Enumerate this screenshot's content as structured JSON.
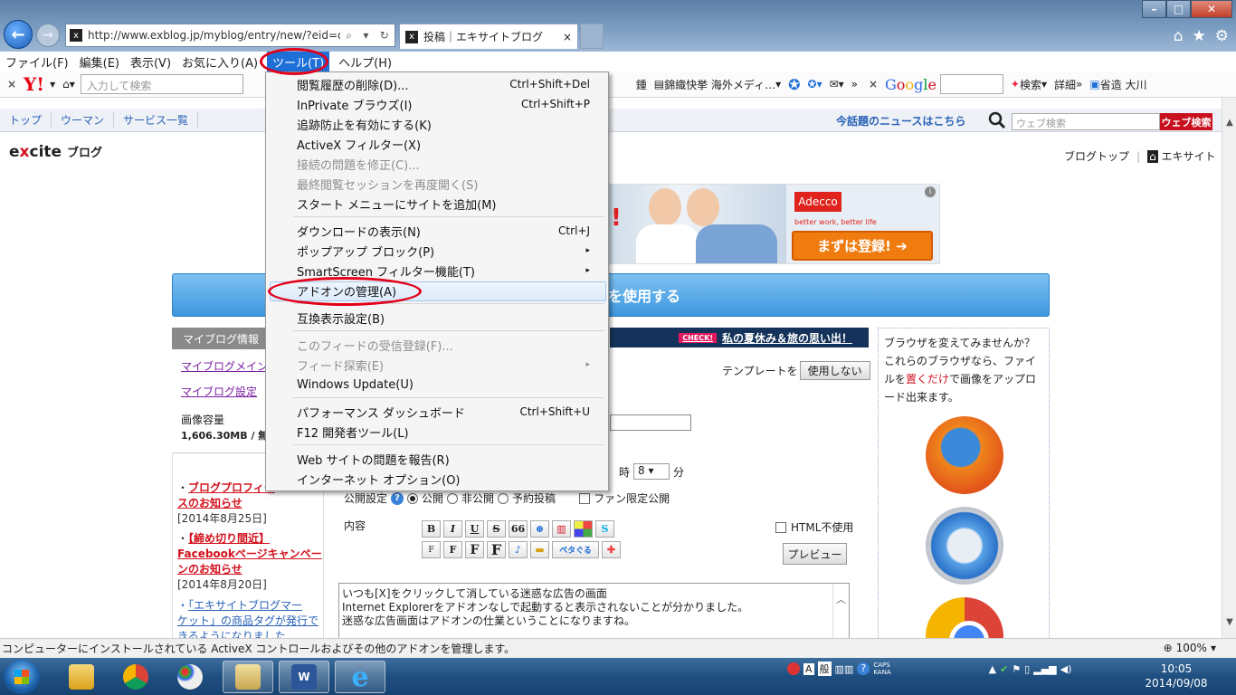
{
  "browser": {
    "address": "http://www.exblog.jp/myblog/entry/new/?eid=d",
    "tab_title": "投稿｜エキサイトブログ",
    "tab_favicon": "x"
  },
  "menubar": [
    {
      "label": "ファイル(F)"
    },
    {
      "label": "編集(E)"
    },
    {
      "label": "表示(V)"
    },
    {
      "label": "お気に入り(A)"
    },
    {
      "label": "ツール(T)",
      "active": true
    },
    {
      "label": "ヘルプ(H)"
    }
  ],
  "toolbar": {
    "yahoo": "Y!",
    "search_placeholder": "入力して検索",
    "item1": "鍾",
    "item2": "錦織快挙 海外メディ…",
    "google": [
      "G",
      "o",
      "o",
      "g",
      "l",
      "e"
    ],
    "search_btn": "検索",
    "detail": "詳細",
    "user": "省造 大川"
  },
  "site": {
    "nav": [
      "トップ",
      "ウーマン",
      "サービス一覧"
    ],
    "news_link": "今話題のニュースはこちら",
    "websearch_placeholder": "ウェブ検索",
    "websearch_btn": "ウェブ検索",
    "logo_e": "e",
    "logo_x": "x",
    "logo_cite": "cite",
    "logo_blog": "ブログ",
    "toplink1": "ブログトップ",
    "toplink2": "エキサイト",
    "ad_brand": "Adecco",
    "ad_tag": "better work, better life",
    "ad_cta": "まずは登録!",
    "banner_text": "を使用する",
    "side_header": "マイブログ情報",
    "side_link1": "マイブログメイン",
    "side_link2": "マイブログ設定",
    "capacity_label": "画像容量",
    "capacity_value": "1,606.30MB / 無",
    "news": [
      {
        "title": "ブログプロフィー",
        "title2": "スのお知らせ",
        "date": "[2014年8月25日]"
      },
      {
        "title": "【締め切り間近】",
        "title2": "Facebookページキャンペー",
        "title3": "ンのお知らせ",
        "date": "[2014年8月20日]"
      },
      {
        "title": "「エキサイトブログマー",
        "title2": "ケット」の商品タグが発行で",
        "title3": "きるようになりました"
      }
    ],
    "check_badge": "CHECK!",
    "check_text": "私の夏休み＆旅の思い出！",
    "template_label": "テンプレートを",
    "template_btn": "使用しない",
    "hour_label": "時",
    "minute_value": "8",
    "minute_label": "分",
    "pub_label": "公開設定",
    "pub_options": [
      "公開",
      "非公開",
      "予約投稿"
    ],
    "fan_only": "ファン限定公開",
    "content_label": "内容",
    "html_off": "HTML不使用",
    "preview_btn": "プレビュー",
    "editor_lines": [
      "いつも[X]をクリックして消している迷惑な広告の画面",
      "Internet Explorerをアドオンなしで起動すると表示されないことが分かりました。",
      "迷惑な広告画面はアドオンの仕業ということになりますね。"
    ],
    "right_text1": "ブラウザを変えてみませんか？これらのブラウザなら、ファイルを",
    "right_em": "置くだけ",
    "right_text2": "で画像をアップロード出来ます。",
    "fmt_row1": [
      "B",
      "I",
      "U",
      "S",
      "66",
      "",
      "",
      "",
      ""
    ],
    "fmt_row2": [
      "F",
      "F",
      "F",
      "F",
      "",
      "",
      "ペタぐる",
      ""
    ],
    "peta": "ペタぐる"
  },
  "menu": {
    "items": [
      {
        "label": "閲覧履歴の削除(D)...",
        "shortcut": "Ctrl+Shift+Del"
      },
      {
        "label": "InPrivate ブラウズ(I)",
        "shortcut": "Ctrl+Shift+P"
      },
      {
        "label": "追跡防止を有効にする(K)",
        "shortcut": ""
      },
      {
        "label": "ActiveX フィルター(X)",
        "shortcut": ""
      },
      {
        "label": "接続の問題を修正(C)...",
        "shortcut": "",
        "disabled": true
      },
      {
        "label": "最終閲覧セッションを再度開く(S)",
        "shortcut": "",
        "disabled": true
      },
      {
        "label": "スタート メニューにサイトを追加(M)",
        "shortcut": ""
      },
      {
        "label": "ダウンロードの表示(N)",
        "shortcut": "Ctrl+J"
      },
      {
        "label": "ポップアップ ブロック(P)",
        "shortcut": "▸"
      },
      {
        "label": "SmartScreen フィルター機能(T)",
        "shortcut": "▸"
      },
      {
        "label": "アドオンの管理(A)",
        "shortcut": "",
        "highlight": true
      },
      {
        "label": "互換表示設定(B)",
        "shortcut": ""
      },
      {
        "label": "このフィードの受信登録(F)...",
        "shortcut": "",
        "disabled": true
      },
      {
        "label": "フィード探索(E)",
        "shortcut": "▸",
        "disabled": true
      },
      {
        "label": "Windows Update(U)",
        "shortcut": ""
      },
      {
        "label": "パフォーマンス ダッシュボード",
        "shortcut": "Ctrl+Shift+U"
      },
      {
        "label": "F12 開発者ツール(L)",
        "shortcut": ""
      },
      {
        "label": "Web サイトの問題を報告(R)",
        "shortcut": ""
      },
      {
        "label": "インターネット オプション(O)",
        "shortcut": ""
      }
    ]
  },
  "status": {
    "text": "コンピューターにインストールされている ActiveX コントロールおよびその他のアドオンを管理します。",
    "zoom": "100%"
  },
  "taskbar": {
    "ime_mode": "A",
    "ime_label": "般",
    "caps": "CAPS",
    "kana": "KANA",
    "time": "10:05",
    "date": "2014/09/08"
  },
  "colors": {
    "accent": "#1e6fd8",
    "annotation_ring": "#e2001a",
    "excite_red": "#d2111d"
  }
}
